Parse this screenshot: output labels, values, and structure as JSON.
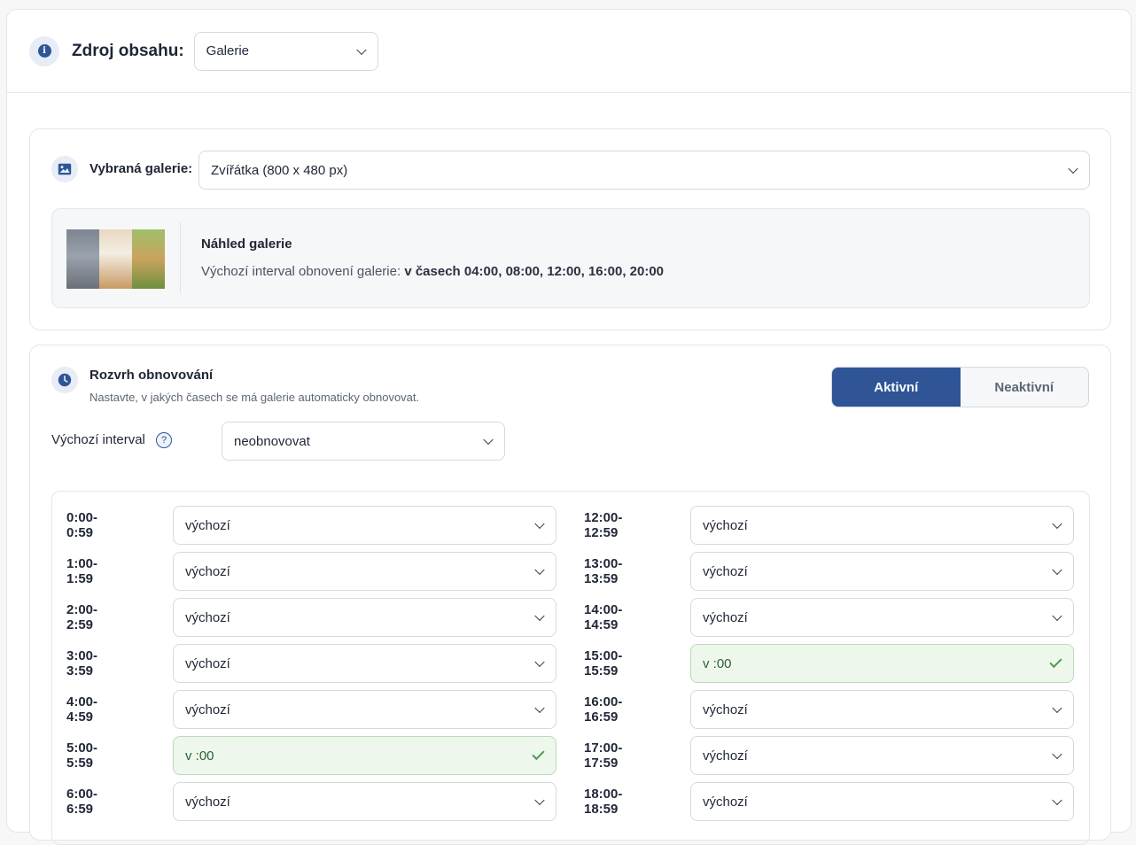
{
  "header": {
    "icon": "info-icon",
    "label": "Zdroj obsahu:",
    "source_select": "Galerie"
  },
  "gallery": {
    "icon": "image-icon",
    "label": "Vybraná galerie:",
    "selected": "Zvířátka (800 x 480 px)",
    "preview_title": "Náhled galerie",
    "interval_prefix": "Výchozí interval obnovení galerie: ",
    "interval_value": "v časech 04:00, 08:00, 12:00, 16:00, 20:00"
  },
  "schedule": {
    "icon": "clock-icon",
    "title": "Rozvrh obnovování",
    "subtitle": "Nastavte, v jakých časech se má galerie automaticky obnovovat.",
    "toggle": {
      "active": "Aktivní",
      "inactive": "Neaktivní",
      "selected": "Aktivní"
    },
    "default_interval_label": "Výchozí interval",
    "default_interval_help": "?",
    "default_interval_value": "neobnovovat",
    "left_rows": [
      {
        "label": "0:00-0:59",
        "value": "výchozí",
        "ok": false
      },
      {
        "label": "1:00-1:59",
        "value": "výchozí",
        "ok": false
      },
      {
        "label": "2:00-2:59",
        "value": "výchozí",
        "ok": false
      },
      {
        "label": "3:00-3:59",
        "value": "výchozí",
        "ok": false
      },
      {
        "label": "4:00-4:59",
        "value": "výchozí",
        "ok": false
      },
      {
        "label": "5:00-5:59",
        "value": "v :00",
        "ok": true
      },
      {
        "label": "6:00-6:59",
        "value": "výchozí",
        "ok": false
      }
    ],
    "right_rows": [
      {
        "label": "12:00-12:59",
        "value": "výchozí",
        "ok": false
      },
      {
        "label": "13:00-13:59",
        "value": "výchozí",
        "ok": false
      },
      {
        "label": "14:00-14:59",
        "value": "výchozí",
        "ok": false
      },
      {
        "label": "15:00-15:59",
        "value": "v :00",
        "ok": true
      },
      {
        "label": "16:00-16:59",
        "value": "výchozí",
        "ok": false
      },
      {
        "label": "17:00-17:59",
        "value": "výchozí",
        "ok": false
      },
      {
        "label": "18:00-18:59",
        "value": "výchozí",
        "ok": false
      }
    ]
  },
  "colors": {
    "accent": "#2f5597",
    "success_bg": "#eef7ec",
    "success": "#4a9b4f"
  }
}
